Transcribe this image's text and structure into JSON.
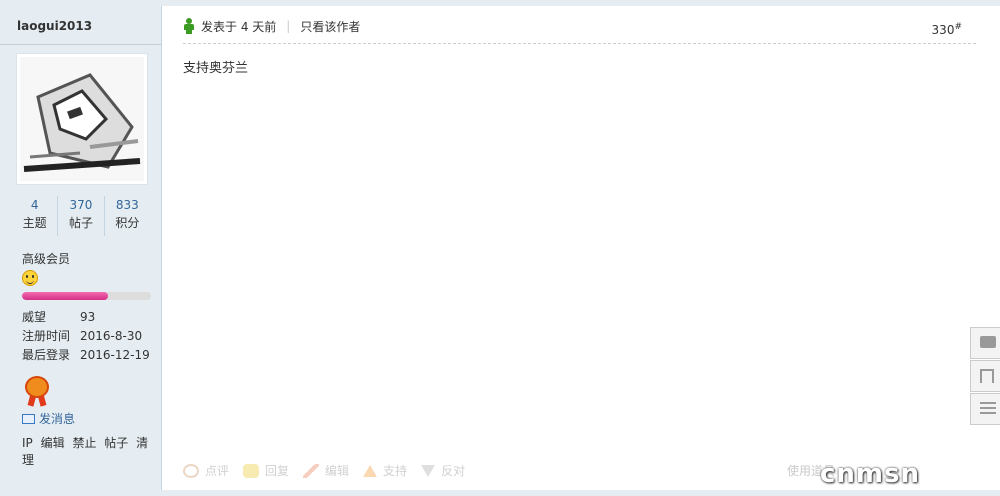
{
  "author": {
    "username": "laogui2013",
    "stats": [
      {
        "value": "4",
        "label": "主题"
      },
      {
        "value": "370",
        "label": "帖子"
      },
      {
        "value": "833",
        "label": "积分"
      }
    ],
    "rank": "高级会员",
    "rank_progress": 0.67,
    "info": [
      {
        "key": "威望",
        "value": "93"
      },
      {
        "key": "注册时间",
        "value": "2016-8-30"
      },
      {
        "key": "最后登录",
        "value": "2016-12-19"
      }
    ],
    "send_message": "发消息",
    "admin_links": [
      "IP",
      "编辑",
      "禁止",
      "帖子",
      "清理"
    ]
  },
  "post": {
    "posted": "发表于 4 天前",
    "only_author": "只看该作者",
    "floor": "330",
    "floor_sup": "#",
    "content": "支持奥芬兰"
  },
  "actions": [
    "点评",
    "回复",
    "编辑",
    "支持",
    "反对"
  ],
  "right_actions": "使用道具",
  "watermark": "cnmsn",
  "colors": {
    "sidebar_bg": "#e5edf2",
    "link_blue": "#336699",
    "progress_pink": "#e04594"
  }
}
